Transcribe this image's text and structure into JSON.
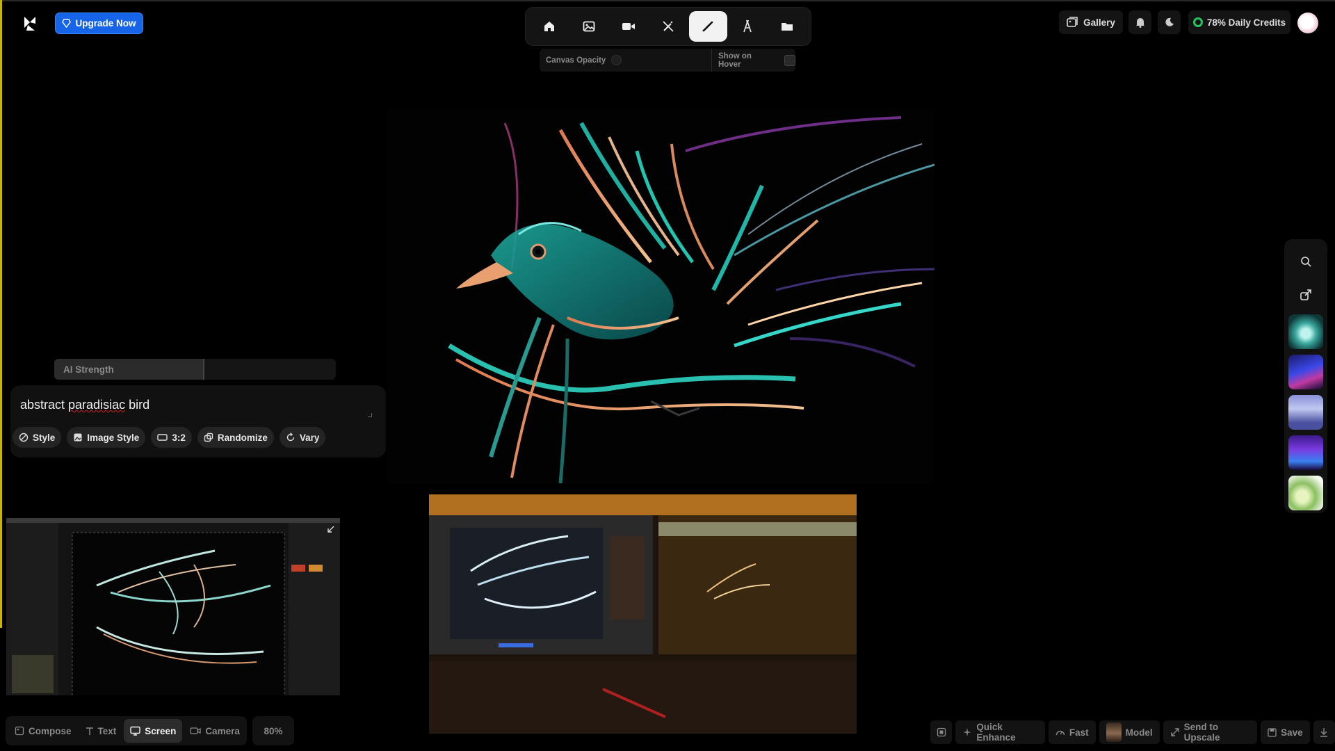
{
  "header": {
    "upgrade_label": "Upgrade Now",
    "gallery_label": "Gallery",
    "credits_label": "78% Daily Credits"
  },
  "toolbar": {
    "tools": [
      "home",
      "image",
      "video",
      "enhance",
      "draw",
      "text",
      "folder"
    ],
    "active_tool": "draw",
    "canvas_opacity_label": "Canvas Opacity",
    "show_on_hover_label": "Show on Hover"
  },
  "prompt": {
    "ai_strength_label": "AI Strength",
    "text": "abstract paradisiac bird",
    "chips": {
      "style": "Style",
      "image_style": "Image Style",
      "ratio": "3:2",
      "randomize": "Randomize",
      "vary": "Vary"
    }
  },
  "modes": {
    "compose": "Compose",
    "text": "Text",
    "screen": "Screen",
    "camera": "Camera",
    "active": "Screen",
    "zoom": "80%"
  },
  "actions": {
    "quick_enhance": "Quick Enhance",
    "fast": "Fast",
    "model": "Model",
    "send_to_upscale": "Send to Upscale",
    "save": "Save"
  },
  "colors": {
    "accent_blue": "#1665e8",
    "credits_green": "#22c55e",
    "panel_bg": "#121212"
  }
}
